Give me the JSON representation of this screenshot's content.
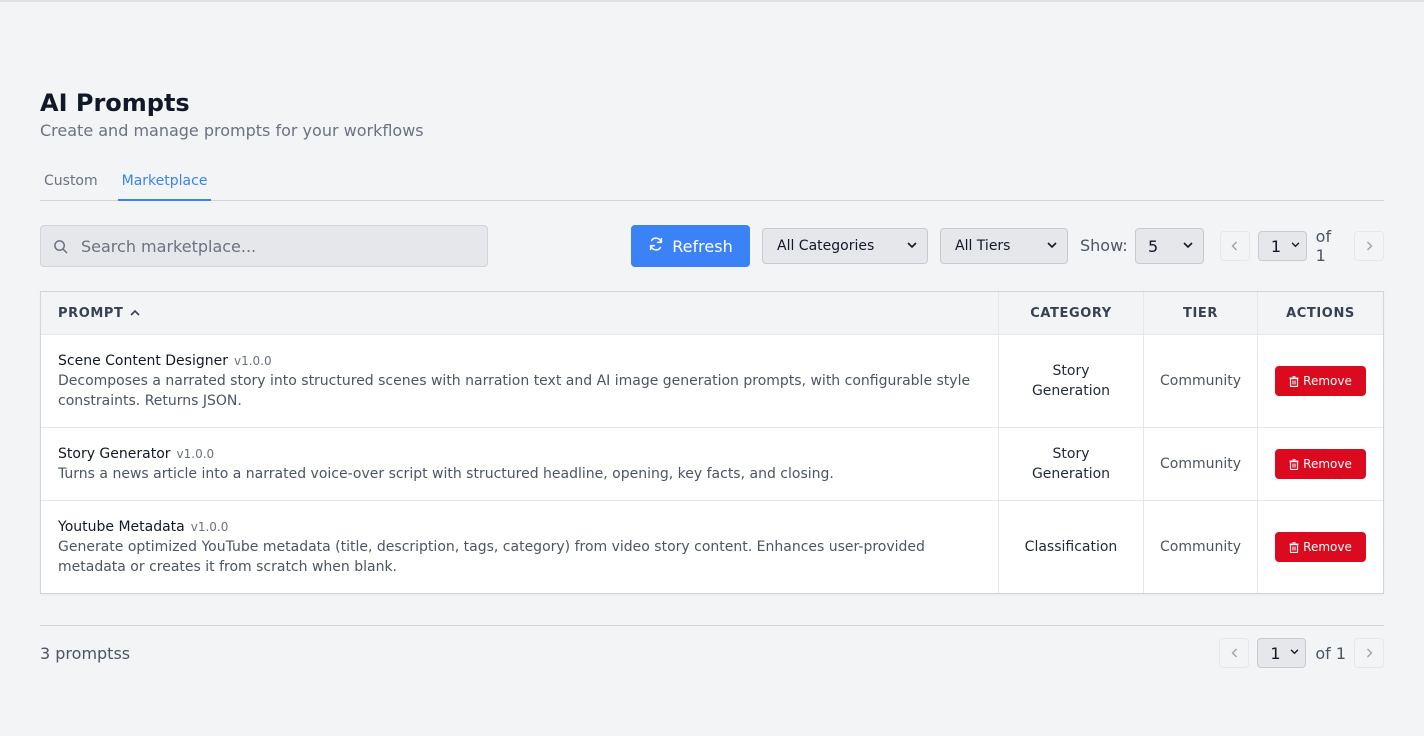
{
  "header": {
    "title": "AI Prompts",
    "subtitle": "Create and manage prompts for your workflows"
  },
  "tabs": [
    {
      "label": "Custom",
      "active": false
    },
    {
      "label": "Marketplace",
      "active": true
    }
  ],
  "toolbar": {
    "search_placeholder": "Search marketplace...",
    "refresh_label": "Refresh",
    "category_value": "All Categories",
    "tier_value": "All Tiers",
    "show_label": "Show:",
    "show_value": "5",
    "page_value": "1",
    "page_of": "of 1"
  },
  "table": {
    "columns": [
      "PROMPT",
      "CATEGORY",
      "TIER",
      "ACTIONS"
    ],
    "sort_column": "PROMPT",
    "sort_direction": "ascending",
    "rows": [
      {
        "name": "Scene Content Designer",
        "version": "v1.0.0",
        "description": "Decomposes a narrated story into structured scenes with narration text and AI image generation prompts, with configurable style constraints. Returns JSON.",
        "category_line1": "Story",
        "category_line2": "Generation",
        "tier": "Community",
        "action": "Remove"
      },
      {
        "name": "Story Generator",
        "version": "v1.0.0",
        "description": "Turns a news article into a narrated voice-over script with structured headline, opening, key facts, and closing.",
        "category_line1": "Story",
        "category_line2": "Generation",
        "tier": "Community",
        "action": "Remove"
      },
      {
        "name": "Youtube Metadata",
        "version": "v1.0.0",
        "description": "Generate optimized YouTube metadata (title, description, tags, category) from video story content. Enhances user-provided metadata or creates it from scratch when blank.",
        "category_line1": "Classification",
        "category_line2": "",
        "tier": "Community",
        "action": "Remove"
      }
    ]
  },
  "footer": {
    "count_text": "3 promptss",
    "page_value": "1",
    "page_of": "of 1"
  },
  "colors": {
    "accent": "#3b82f6",
    "danger": "#dc0a1e",
    "background": "#f3f4f6"
  },
  "icons": {
    "search": "search-icon",
    "refresh": "refresh-icon",
    "trash": "trash-icon",
    "prev": "chevron-left-icon",
    "next": "chevron-right-icon",
    "sort": "chevron-up-icon"
  }
}
